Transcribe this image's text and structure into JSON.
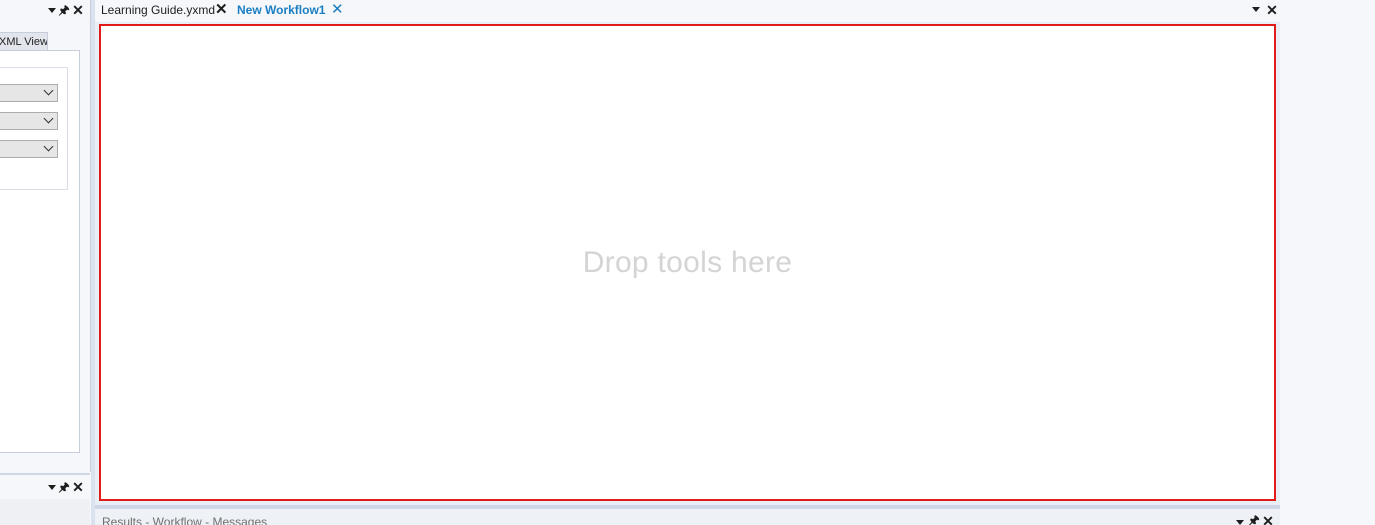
{
  "left_panel": {
    "tab_label": "XML View",
    "combos": [
      {
        "value": ""
      },
      {
        "value": ""
      },
      {
        "value": ""
      }
    ]
  },
  "document_tabs": [
    {
      "label": "Learning Guide.yxmd",
      "active": false
    },
    {
      "label": "New Workflow1",
      "active": true
    }
  ],
  "canvas": {
    "hint": "Drop tools here",
    "border_color": "#e11a1a"
  },
  "results_pane": {
    "title": "Results - Workflow - Messages"
  },
  "colors": {
    "active_tab": "#1a7ec2",
    "hint_text": "#d4d4d4"
  },
  "icons": {
    "pane_menu": "chevron-down-icon",
    "pin": "pin-icon",
    "close": "close-icon"
  }
}
